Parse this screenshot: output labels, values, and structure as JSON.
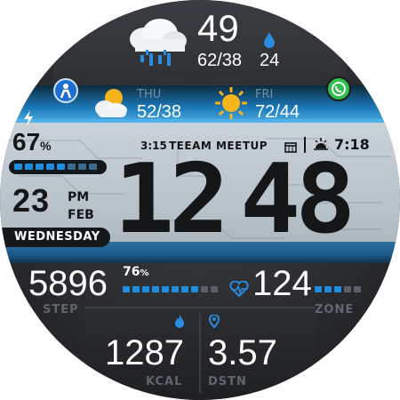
{
  "weather_now": {
    "temp": "49",
    "range": "62/38",
    "humidity": "24",
    "icon": "rain-cloud-icon"
  },
  "forecast": [
    {
      "day": "THU",
      "range": "52/38",
      "icon": "partly-sunny-icon"
    },
    {
      "day": "FRI",
      "range": "72/44",
      "icon": "sun-icon"
    }
  ],
  "battery": {
    "percent": "67",
    "unit": "%",
    "level": 0.67
  },
  "date": {
    "day": "23",
    "ampm": "PM",
    "month": "FEB",
    "weekday": "WEDNESDAY"
  },
  "event": {
    "time": "3:15",
    "title": "TEEAM MEETUP"
  },
  "sunrise": {
    "time": "7:18"
  },
  "clock": {
    "time": "12:48",
    "hours": "12",
    "minutes": "48"
  },
  "steps": {
    "value": "5896",
    "percent": "76",
    "unit": "%",
    "label": "STEP",
    "level": 0.76
  },
  "heart": {
    "value": "124",
    "label": "ZONE"
  },
  "calories": {
    "value": "1287",
    "label": "KCAL"
  },
  "distance": {
    "value": "3.57",
    "label": "DSTN"
  },
  "apps": {
    "left": "app-shortcut-icon",
    "right": "whatsapp-icon"
  },
  "colors": {
    "accent": "#1f8ee0",
    "segment_dim": "#3a6a8d",
    "band": "#c4cdd3"
  }
}
